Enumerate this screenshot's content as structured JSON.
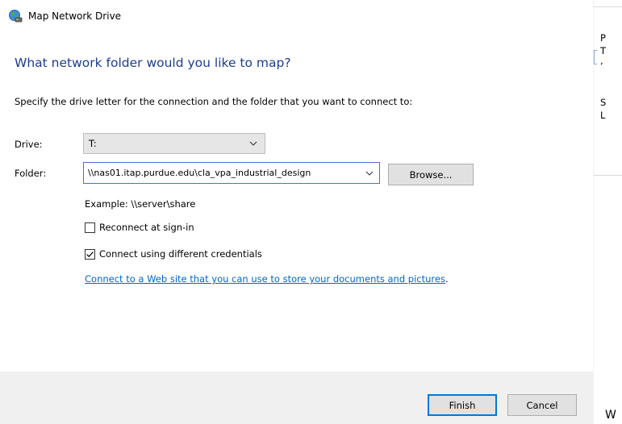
{
  "window": {
    "title": "Map Network Drive",
    "icon": "network-drive-icon"
  },
  "main": {
    "heading": "What network folder would you like to map?",
    "instruction": "Specify the drive letter for the connection and the folder that you want to connect to:",
    "drive": {
      "label": "Drive:",
      "value": "T:"
    },
    "folder": {
      "label": "Folder:",
      "value": "\\\\nas01.itap.purdue.edu\\cla_vpa_industrial_design",
      "browse_label": "Browse..."
    },
    "example": "Example: \\\\server\\share",
    "reconnect": {
      "label": "Reconnect at sign-in",
      "checked": false
    },
    "credentials": {
      "label": "Connect using different credentials",
      "checked": true
    },
    "link": {
      "text": "Connect to a Web site that you can use to store your documents and pictures",
      "suffix": "."
    }
  },
  "footer": {
    "finish_label": "Finish",
    "cancel_label": "Cancel"
  },
  "background_window": {
    "chars": [
      "P",
      "T",
      ",",
      "S",
      "L"
    ],
    "bottom_text": "W"
  },
  "colors": {
    "heading": "#1e3d8f",
    "link": "#0066cc",
    "focus_border": "#0078d7",
    "footer_bg": "#f0f0f0"
  }
}
